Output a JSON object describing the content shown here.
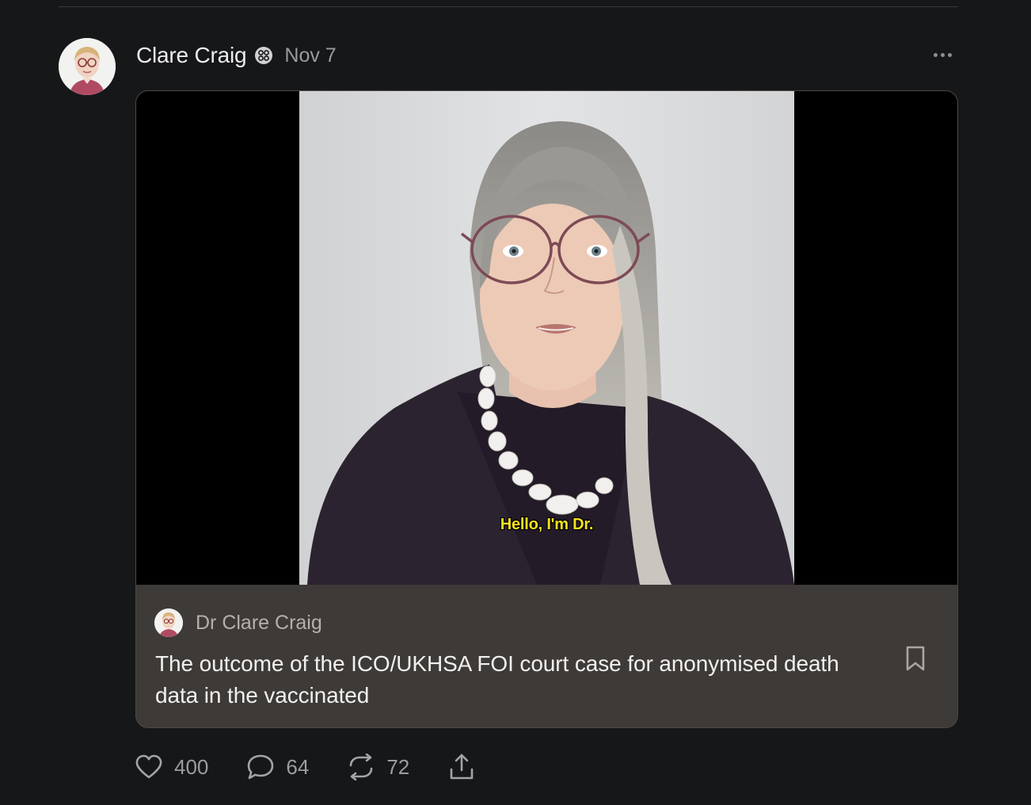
{
  "post": {
    "author_name": "Clare Craig",
    "date": "Nov 7",
    "author_avatar": "author-avatar-photo",
    "badge_icon": "verified-badge-icon",
    "more_icon": "more-options-icon"
  },
  "embed": {
    "video_caption": "Hello, I'm Dr.",
    "publication_name": "Dr Clare Craig",
    "title": "The outcome of the ICO/UKHSA FOI court case for anonymised death data in the vaccinated",
    "bookmark_icon": "bookmark-icon"
  },
  "actions": {
    "likes": "400",
    "comments": "64",
    "restacks": "72",
    "like_icon": "heart-icon",
    "comment_icon": "comment-icon",
    "restack_icon": "restack-icon",
    "share_icon": "share-icon"
  },
  "colors": {
    "background": "#161719",
    "card": "#3e3a37",
    "caption": "#f7e11e",
    "muted": "#9c9da0"
  }
}
